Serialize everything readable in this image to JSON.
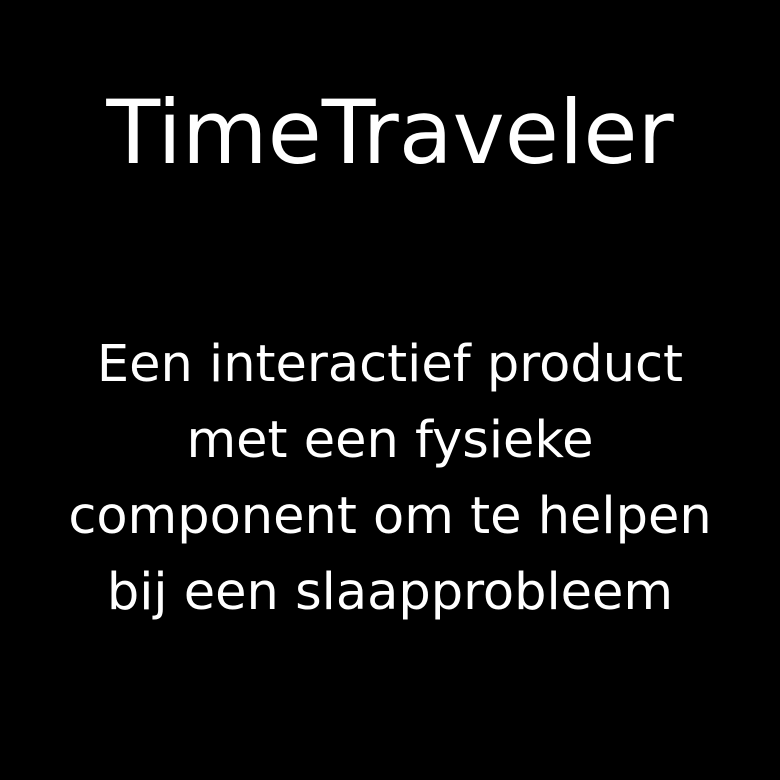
{
  "title": "TimeTraveler",
  "subtitle_lines": [
    "Een interactief product",
    "met een fysieke",
    "component om te helpen",
    "bij een slaapprobleem"
  ],
  "colors": {
    "background": "#000000",
    "text": "#ffffff"
  }
}
